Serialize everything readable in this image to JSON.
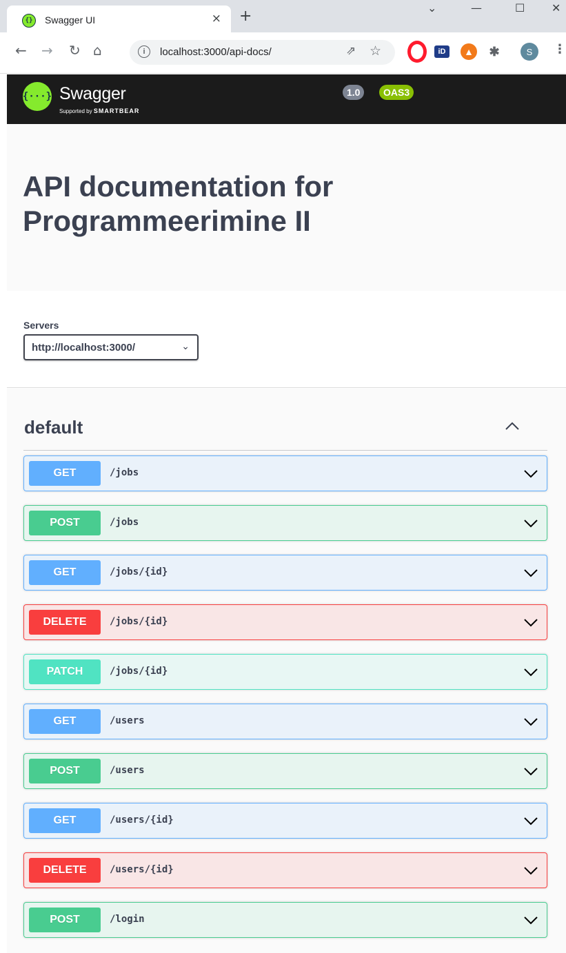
{
  "browser": {
    "tab_title": "Swagger UI",
    "tab_close": "×",
    "new_tab": "+",
    "url": "localhost:3000/api-docs/",
    "avatar_letter": "S",
    "ext_id_label": "iD"
  },
  "header": {
    "brand": "Swagger",
    "supported_by": "Supported by",
    "smartbear": "SMARTBEAR",
    "logo_glyph": "{···}"
  },
  "info": {
    "title_line1": "API documentation for",
    "title_line2": "Programmeerimine II",
    "version": "1.0",
    "oas": "OAS3"
  },
  "servers": {
    "label": "Servers",
    "selected": "http://localhost:3000/"
  },
  "tag": {
    "name": "default"
  },
  "colors": {
    "get": "#61affe",
    "post": "#49cc90",
    "delete": "#f93e3e",
    "patch": "#50e3c2",
    "header_bg": "#1b1b1b",
    "swagger_green": "#85ea2d"
  },
  "operations": [
    {
      "method": "GET",
      "path": "/jobs"
    },
    {
      "method": "POST",
      "path": "/jobs"
    },
    {
      "method": "GET",
      "path": "/jobs/{id}"
    },
    {
      "method": "DELETE",
      "path": "/jobs/{id}"
    },
    {
      "method": "PATCH",
      "path": "/jobs/{id}"
    },
    {
      "method": "GET",
      "path": "/users"
    },
    {
      "method": "POST",
      "path": "/users"
    },
    {
      "method": "GET",
      "path": "/users/{id}"
    },
    {
      "method": "DELETE",
      "path": "/users/{id}"
    },
    {
      "method": "POST",
      "path": "/login"
    }
  ]
}
